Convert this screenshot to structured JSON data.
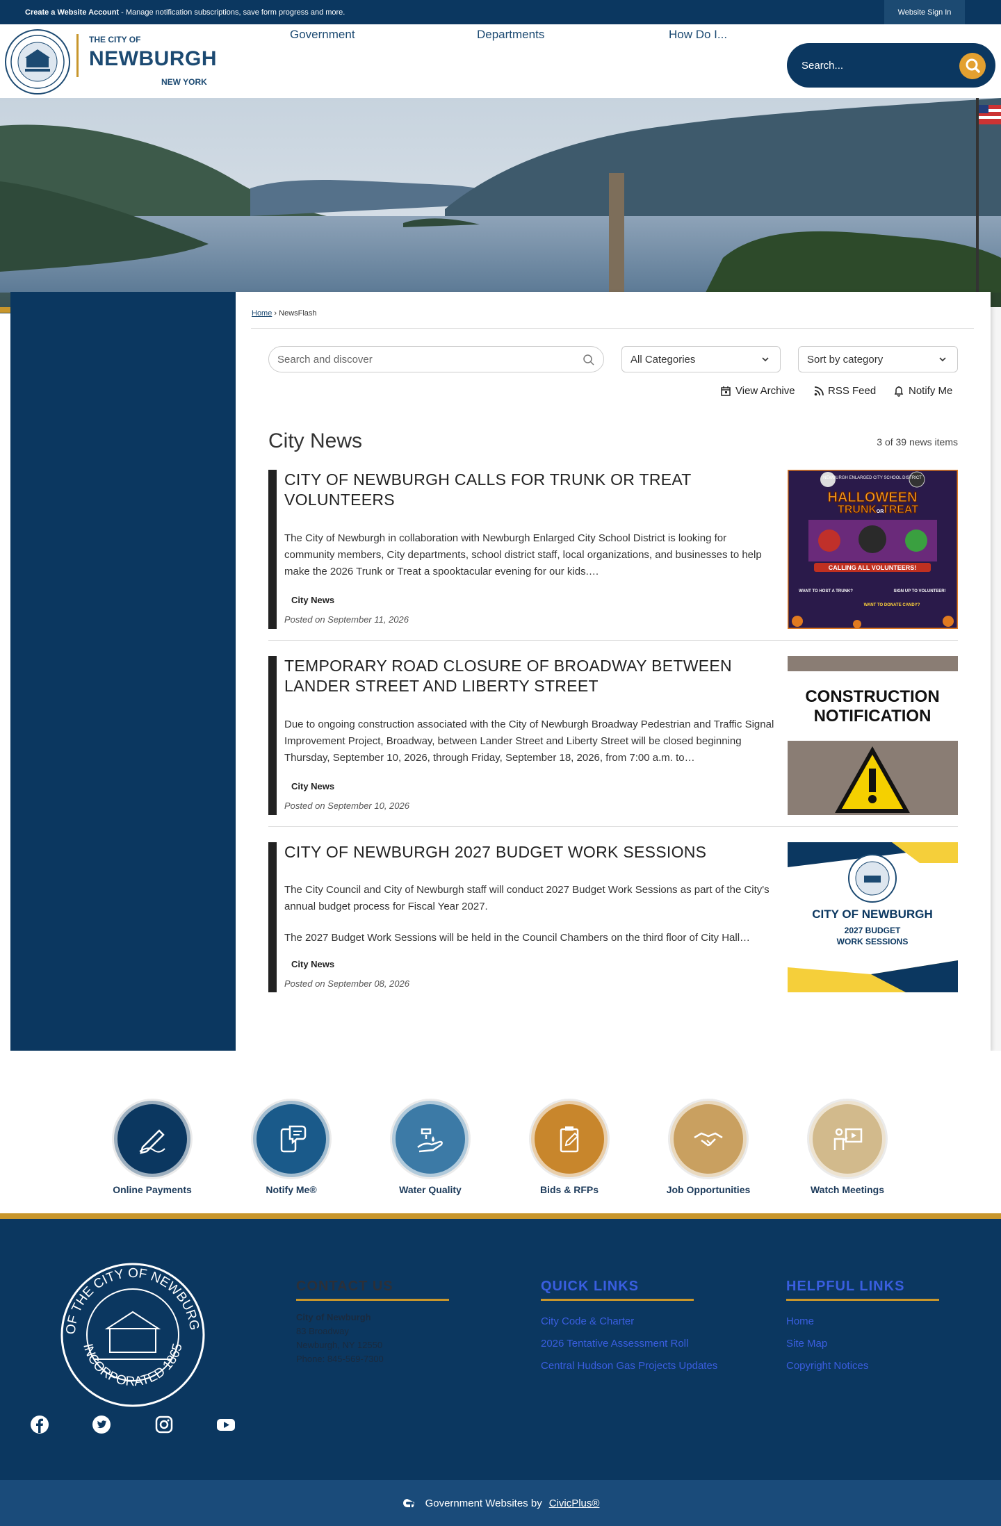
{
  "topbar": {
    "account_bold": "Create a Website Account",
    "account_rest": " - Manage notification subscriptions, save form progress and more.",
    "signin": "Website Sign In"
  },
  "header": {
    "logo_small": "THE CITY OF",
    "logo_big": "NEWBURGH",
    "logo_state": "NEW YORK",
    "seal_text": "SEAL OF THE CITY OF NEWBURGH N.Y. INCORPORATED 1865",
    "nav": [
      "Government",
      "Departments",
      "How Do I..."
    ],
    "search_placeholder": "Search..."
  },
  "breadcrumb": {
    "home": "Home",
    "sep": "›",
    "current": "NewsFlash"
  },
  "filters": {
    "search_placeholder": "Search and discover",
    "category": "All Categories",
    "sort": "Sort by category"
  },
  "tools": {
    "archive": "View Archive",
    "rss": "RSS Feed",
    "notify": "Notify Me"
  },
  "news": {
    "heading": "City News",
    "count": "3 of 39 news items",
    "items": [
      {
        "title": "CITY OF NEWBURGH CALLS FOR TRUNK OR TREAT VOLUNTEERS",
        "desc": "The City of Newburgh in collaboration with Newburgh Enlarged City School District is looking for community members, City departments, school district staff, local organizations, and businesses to help make the 2026 Trunk or Treat a spooktacular evening for our kids.…",
        "category": "City News",
        "date": "Posted on September 11, 2026",
        "thumb": {
          "line1": "NEWBURGH ENLARGED CITY SCHOOL DISTRICT",
          "line2": "HALLOWEEN",
          "line3": "TRUNK",
          "line4": "OR",
          "line5": "TREAT",
          "line6": "CALLING ALL VOLUNTEERS!",
          "line7": "WANT TO HOST A TRUNK?",
          "line8": "SIGN UP TO VOLUNTEER!",
          "line9": "WANT TO DONATE CANDY?"
        }
      },
      {
        "title": "TEMPORARY ROAD CLOSURE OF BROADWAY BETWEEN LANDER STREET AND LIBERTY STREET",
        "desc": "Due to ongoing construction associated with the City of Newburgh Broadway Pedestrian and Traffic Signal Improvement Project, Broadway, between Lander Street and Liberty Street will be closed beginning Thursday, September 10, 2026, through Friday, September 18, 2026, from 7:00 a.m. to…",
        "category": "City News",
        "date": "Posted on September 10, 2026",
        "thumb": {
          "line1": "CONSTRUCTION",
          "line2": "NOTIFICATION"
        }
      },
      {
        "title": "CITY OF NEWBURGH 2027 BUDGET WORK SESSIONS",
        "desc": "The City Council and City of Newburgh staff will conduct 2027 Budget Work Sessions as part of the City's annual budget process for Fiscal Year 2027.",
        "desc2": "The 2027 Budget Work Sessions will be held in the Council Chambers on the third floor of City Hall…",
        "category": "City News",
        "date": "Posted on September 08, 2026",
        "thumb": {
          "line1": "CITY OF NEWBURGH",
          "line2": "2027 BUDGET",
          "line3": "WORK SESSIONS"
        }
      }
    ]
  },
  "quick_links": [
    {
      "label": "Online Payments",
      "icon": "pen-signature-icon",
      "color": "#0b3760"
    },
    {
      "label": "Notify Me®",
      "icon": "phone-chat-icon",
      "color": "#1a5a8a"
    },
    {
      "label": "Water Quality",
      "icon": "water-hand-icon",
      "color": "#3c7aa6"
    },
    {
      "label": "Bids & RFPs",
      "icon": "clipboard-icon",
      "color": "#c8862c"
    },
    {
      "label": "Job Opportunities",
      "icon": "handshake-icon",
      "color": "#c9a060"
    },
    {
      "label": "Watch Meetings",
      "icon": "presenter-icon",
      "color": "#d2ba8c"
    }
  ],
  "footer": {
    "contact": {
      "heading": "CONTACT US",
      "lines": [
        "City of Newburgh",
        "83 Broadway",
        "Newburgh, NY 12550",
        "Phone: 845-569-7300"
      ]
    },
    "quick": {
      "heading": "QUICK LINKS",
      "links": [
        "City Code & Charter",
        "2026 Tentative Assessment Roll",
        "Central Hudson Gas Projects Updates"
      ]
    },
    "helpful": {
      "heading": "HELPFUL LINKS",
      "links": [
        "Home",
        "Site Map",
        "Copyright Notices"
      ]
    },
    "seal_top": "SEAL OF THE CITY OF NEWBURGH, N.Y.",
    "seal_bottom": "INCORPORATED 1865",
    "social": [
      "facebook-icon",
      "twitter-icon",
      "instagram-icon",
      "youtube-icon"
    ]
  },
  "civic": {
    "prefix": "Government Websites by",
    "link": "CivicPlus®"
  }
}
